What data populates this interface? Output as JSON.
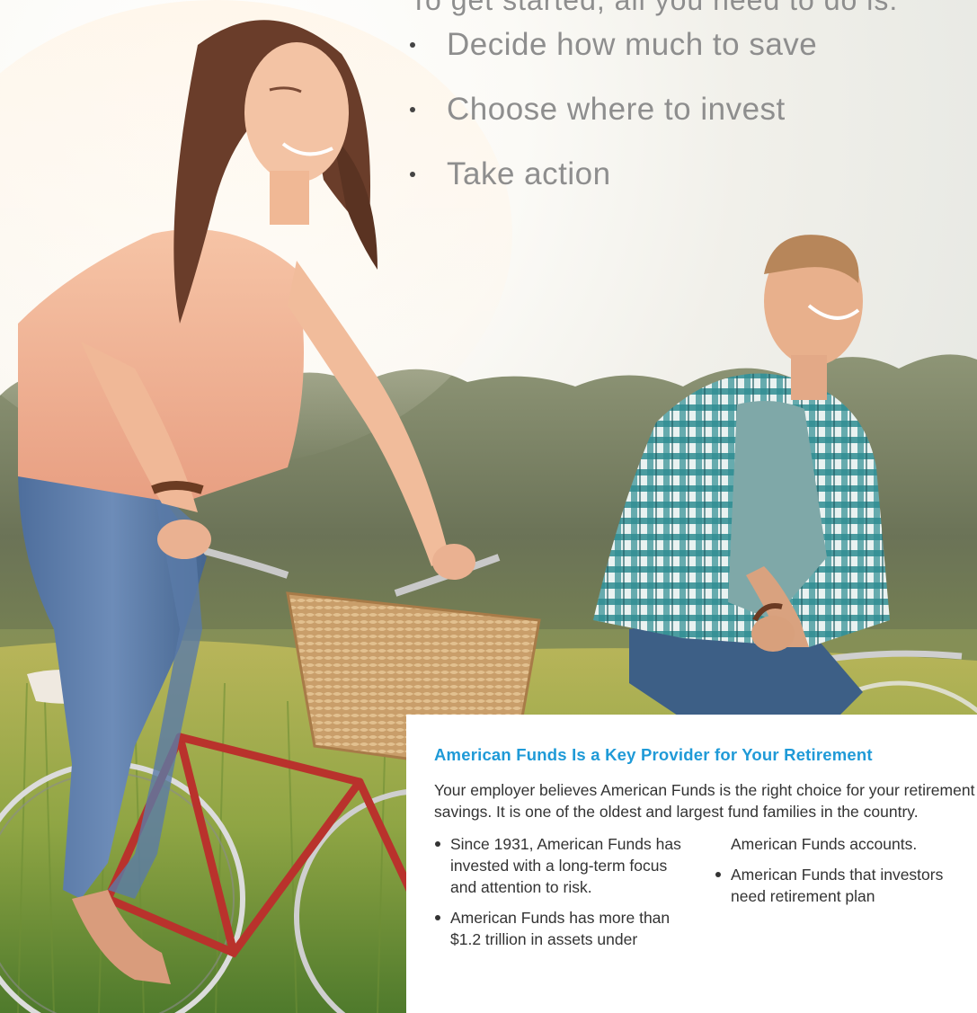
{
  "intro": {
    "lead": "To get started, all you need to do is:",
    "steps": [
      "Decide how much to save",
      "Choose where to invest",
      "Take action"
    ]
  },
  "panel": {
    "title": "American Funds Is a Key Provider for Your Retirement",
    "intro": "Your employer believes American Funds is the right choice for your retirement savings. It is one of the oldest and largest fund families in the country.",
    "left_bullets": [
      "Since 1931, American Funds has invested with a long-term focus and attention to risk.",
      "American Funds has more than $1.2 trillion in assets under"
    ],
    "right_continuation": "American Funds accounts.",
    "right_bullets": [
      "American Funds that investors need retirement plan"
    ]
  },
  "colors": {
    "title_blue": "#1f9ad7",
    "intro_gray": "#8e8e8e"
  }
}
